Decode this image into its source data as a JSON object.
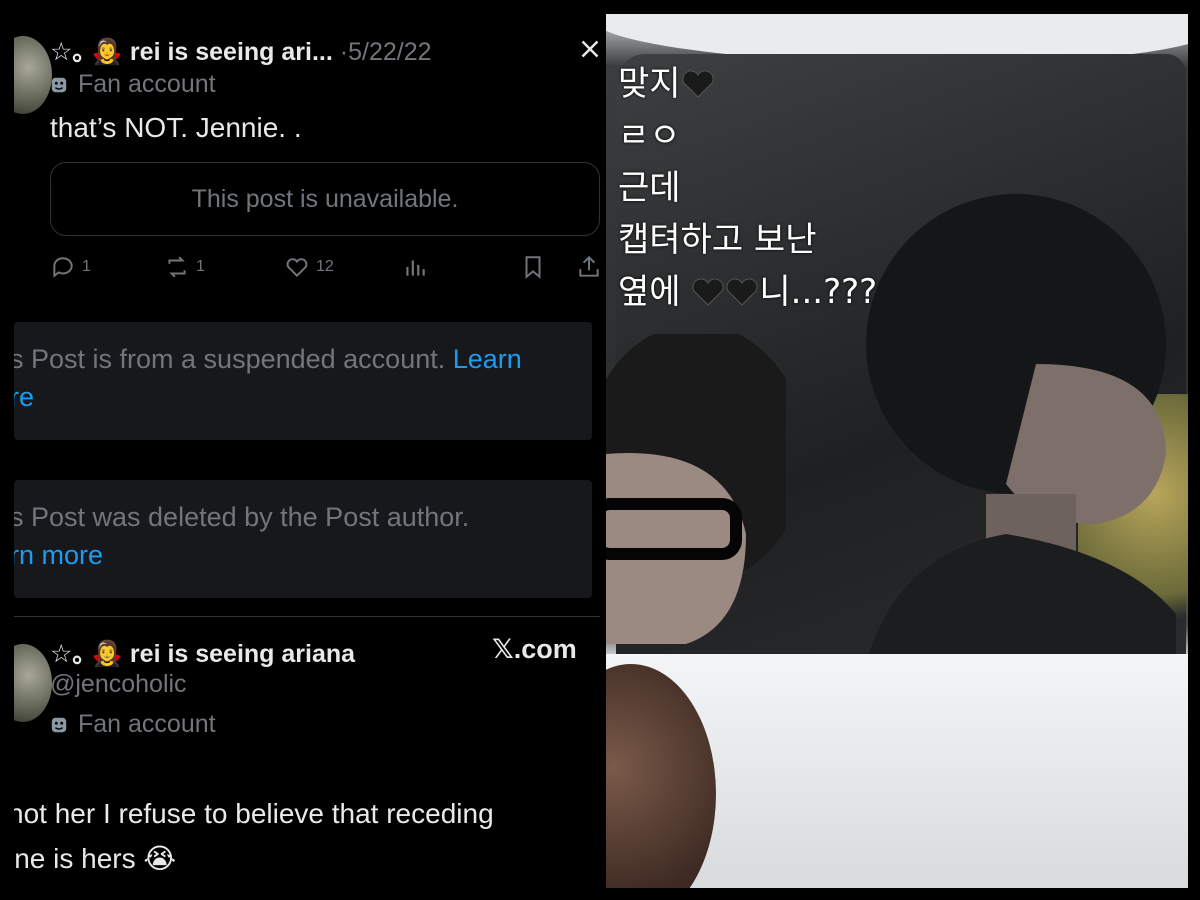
{
  "left_panel": {
    "post1": {
      "display_name": "☆｡ 🧛‍♀️ rei is seeing ari...",
      "dot": "·",
      "date": "5/22/22",
      "label": "Fan account",
      "text": "that’s NOT. Jennie. .",
      "quoted": "This post is unavailable.",
      "actions": {
        "replies": "1",
        "reposts": "1",
        "likes": "12"
      }
    },
    "notice1": {
      "text": "s Post is from a suspended account.",
      "link": "Learn",
      "link_cont": "re"
    },
    "notice2": {
      "text": "s Post was deleted by the Post author.",
      "link": "rn more"
    },
    "post2": {
      "display_name": "☆｡ 🧛‍♀️ rei is seeing ariana",
      "source": "𝕏.com",
      "handle": "@jencoholic",
      "label": "Fan account",
      "text_line1": "not her I refuse to believe that receding",
      "text_line2": "ine is hers 😭"
    }
  },
  "right_panel": {
    "overlay_lines": [
      "맞지",
      "ㄹㅇ",
      "근데",
      "캡텨하고 보난",
      "옆에",
      "니...???"
    ],
    "colors": {
      "heart": "#1a1a1a"
    }
  },
  "colors": {
    "link": "#1d9bf0",
    "muted": "#71767b",
    "text": "#e7e9ea",
    "notice_bg": "#16181c"
  }
}
